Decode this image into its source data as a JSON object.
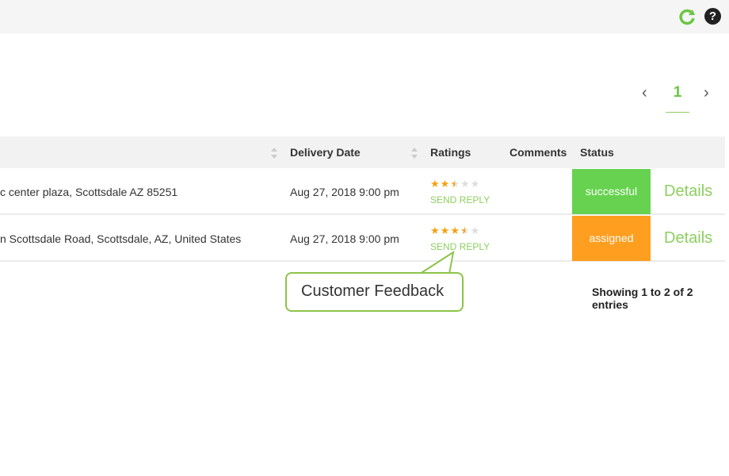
{
  "toolbar": {
    "refresh_icon": "refresh-icon",
    "help_icon": "help-icon",
    "help_glyph": "?",
    "accent": "#6cc644"
  },
  "pagination": {
    "prev": "‹",
    "current": "1",
    "next": "›"
  },
  "table": {
    "headers": {
      "delivery_date": "Delivery Date",
      "ratings": "Ratings",
      "comments": "Comments",
      "status": "Status"
    },
    "rows": [
      {
        "address": "c center plaza, Scottsdale AZ 85251",
        "delivery_date": "Aug 27, 2018 9:00 pm",
        "rating": 2.5,
        "reply": "SEND REPLY",
        "comments": "",
        "status": "successful",
        "status_color": "#66d24f",
        "details": "Details"
      },
      {
        "address": "n Scottsdale Road, Scottsdale, AZ, United States",
        "delivery_date": "Aug 27, 2018 9:00 pm",
        "rating": 3.5,
        "reply": "SEND REPLY",
        "comments": "",
        "status": "assigned",
        "status_color": "#ff9e1f",
        "details": "Details"
      }
    ],
    "info": "Showing 1 to 2 of 2 entries"
  },
  "callout": {
    "text": "Customer Feedback"
  }
}
